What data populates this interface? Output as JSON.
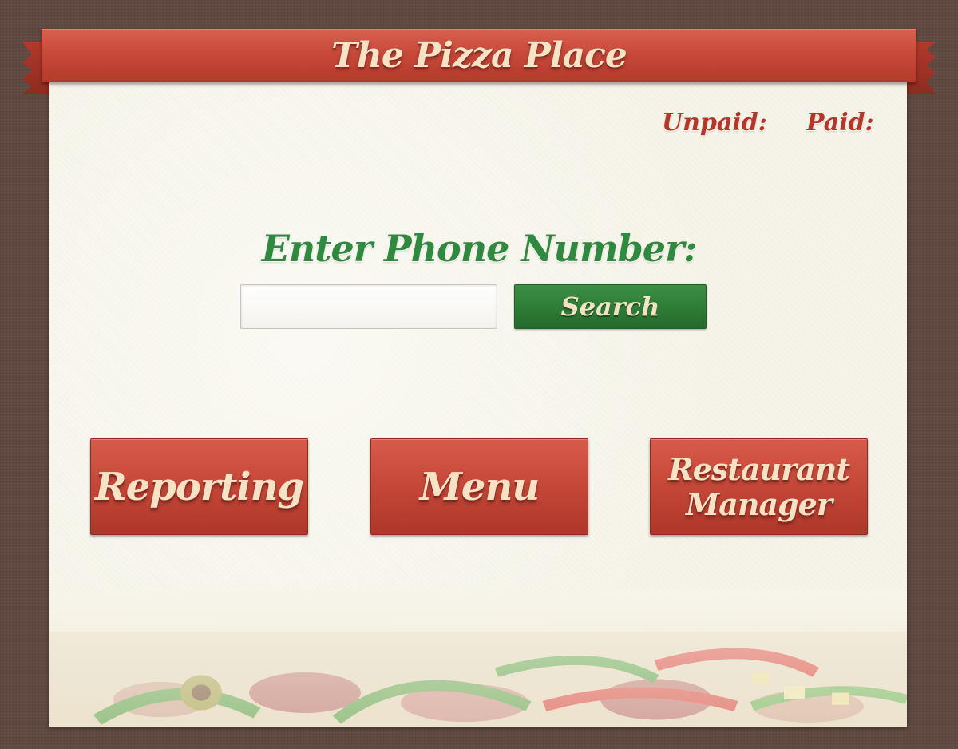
{
  "app": {
    "title": "The Pizza Place"
  },
  "status": {
    "unpaid_label": "Unpaid:",
    "paid_label": "Paid:"
  },
  "lookup": {
    "prompt": "Enter Phone Number:",
    "phone_value": "",
    "search_label": "Search"
  },
  "nav": {
    "reporting_label": "Reporting",
    "menu_label": "Menu",
    "manager_line1": "Restaurant",
    "manager_line2": "Manager"
  },
  "colors": {
    "ribbon_red": "#c8493a",
    "prompt_green": "#2f8a3f",
    "button_cream_text": "#f6e3c6",
    "card_background": "#f6f4e8",
    "page_background": "#5f4940"
  },
  "decoration": {
    "footer_image": "pizza-toppings-photo"
  }
}
